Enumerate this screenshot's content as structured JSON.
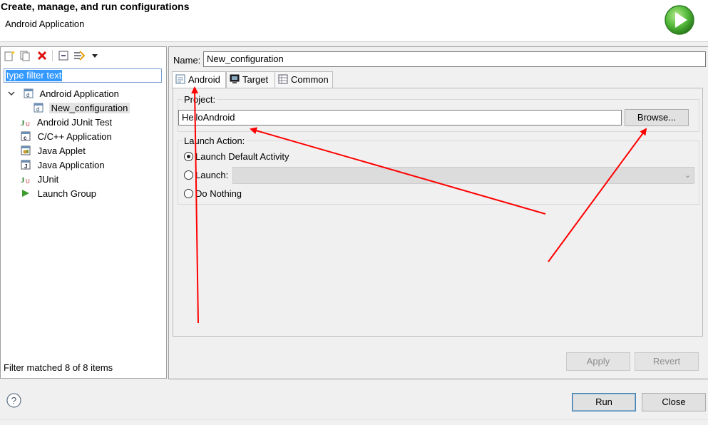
{
  "header": {
    "title": "Create, manage, and run configurations",
    "subtitle": "Android Application"
  },
  "toolbar": {
    "icons": [
      "new-config-icon",
      "duplicate-icon",
      "delete-icon",
      "collapse-all-icon",
      "filter-icon",
      "dropdown-arrow-icon"
    ]
  },
  "filter": {
    "value": "type filter text"
  },
  "tree": {
    "items": [
      {
        "label": "Android Application",
        "icon": "android-app-icon"
      },
      {
        "label": "New_configuration",
        "icon": "android-app-icon"
      },
      {
        "label": "Android JUnit Test",
        "icon": "junit-icon"
      },
      {
        "label": "C/C++ Application",
        "icon": "c-app-icon"
      },
      {
        "label": "Java Applet",
        "icon": "applet-icon"
      },
      {
        "label": "Java Application",
        "icon": "java-app-icon"
      },
      {
        "label": "JUnit",
        "icon": "junit-icon"
      },
      {
        "label": "Launch Group",
        "icon": "launch-group-icon"
      }
    ]
  },
  "status": {
    "filter_matched": "Filter matched 8 of 8 items"
  },
  "config": {
    "name_label": "Name:",
    "name_value": "New_configuration",
    "tabs": [
      {
        "label": "Android",
        "icon": "android-tab-icon"
      },
      {
        "label": "Target",
        "icon": "target-icon"
      },
      {
        "label": "Common",
        "icon": "common-icon"
      }
    ],
    "project_label": "Project:",
    "project_value": "HelloAndroid",
    "browse_label": "Browse...",
    "launch_action_label": "Launch Action:",
    "radios": [
      {
        "label": "Launch Default Activity",
        "checked": true
      },
      {
        "label": "Launch:",
        "checked": false
      },
      {
        "label": "Do Nothing",
        "checked": false
      }
    ]
  },
  "buttons": {
    "apply": "Apply",
    "revert": "Revert",
    "run": "Run",
    "close": "Close"
  },
  "colors": {
    "annotation_arrow": "#ff0000",
    "selection": "#3399ff",
    "run_logo": "#3cad2a"
  }
}
